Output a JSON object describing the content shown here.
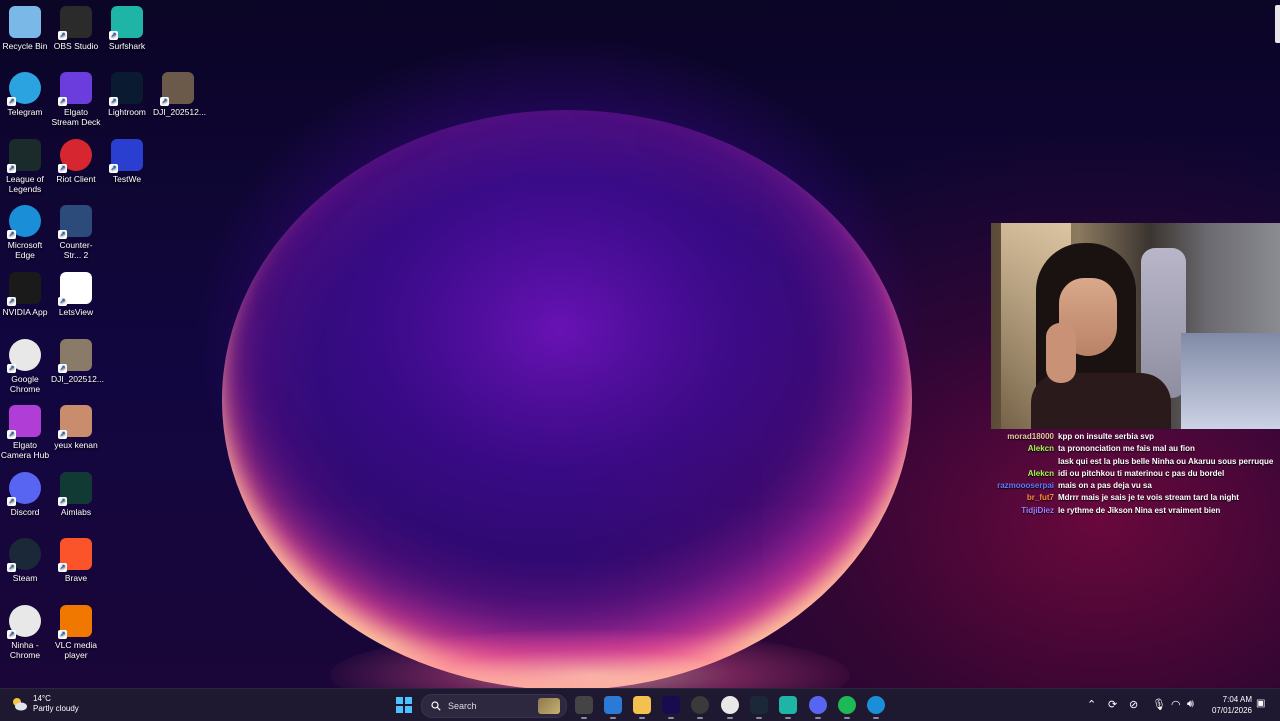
{
  "desktop": {
    "icons": [
      {
        "label": "Recycle Bin",
        "icon": "recycle-bin-icon",
        "color": "#7ab8e8"
      },
      {
        "label": "OBS Studio",
        "icon": "obs-studio-icon",
        "color": "#2b2b2b"
      },
      {
        "label": "Surfshark",
        "icon": "surfshark-icon",
        "color": "#1eb4a6"
      },
      {
        "label": "Telegram",
        "icon": "telegram-icon",
        "color": "#2aa3e0"
      },
      {
        "label": "Elgato Stream Deck",
        "icon": "stream-deck-icon",
        "color": "#6b3ddc"
      },
      {
        "label": "Lightroom",
        "icon": "lightroom-icon",
        "color": "#0a1a30"
      },
      {
        "label": "DJI_202512...",
        "icon": "video-file-icon",
        "color": "#6b5a4a"
      },
      {
        "label": "League of Legends",
        "icon": "league-of-legends-icon",
        "color": "#1b2a2a"
      },
      {
        "label": "Riot Client",
        "icon": "riot-client-icon",
        "color": "#d6262f"
      },
      {
        "label": "TestWe",
        "icon": "testwe-icon",
        "color": "#2a3fd0"
      },
      {
        "label": "Microsoft Edge",
        "icon": "edge-icon",
        "color": "#1a8fd8"
      },
      {
        "label": "Counter-Str... 2",
        "icon": "counter-strike-icon",
        "color": "#2c4a7a"
      },
      {
        "label": "NVIDIA App",
        "icon": "nvidia-icon",
        "color": "#1a1a1a"
      },
      {
        "label": "LetsView",
        "icon": "letsview-icon",
        "color": "#ffffff"
      },
      {
        "label": "Google Chrome",
        "icon": "chrome-icon",
        "color": "#e8e8e8"
      },
      {
        "label": "DJI_202512...",
        "icon": "video-file-icon",
        "color": "#8a7a68"
      },
      {
        "label": "Elgato Camera Hub",
        "icon": "camera-hub-icon",
        "color": "#b03dd6"
      },
      {
        "label": "yeux kenan",
        "icon": "image-file-icon",
        "color": "#c98c6c"
      },
      {
        "label": "Discord",
        "icon": "discord-icon",
        "color": "#5865f2"
      },
      {
        "label": "Aimlabs",
        "icon": "aimlabs-icon",
        "color": "#123a34"
      },
      {
        "label": "Steam",
        "icon": "steam-icon",
        "color": "#1b2838"
      },
      {
        "label": "Brave",
        "icon": "brave-icon",
        "color": "#fb542b"
      },
      {
        "label": "Ninha - Chrome",
        "icon": "chrome-profile-icon",
        "color": "#e8e8e8"
      },
      {
        "label": "VLC media player",
        "icon": "vlc-icon",
        "color": "#f07800"
      }
    ]
  },
  "chat": {
    "messages": [
      {
        "user": "morad18000",
        "color": "#e8c8a0",
        "text": "kpp on insulte serbia svp"
      },
      {
        "user": "Alekcn",
        "color": "#9cff4a",
        "text": "ta prononciation me fais mal au fion"
      },
      {
        "user": "",
        "color": "#ffffff",
        "text": "lask qui est la plus belle Ninha ou Akaruu sous perruque"
      },
      {
        "user": "Alekcn",
        "color": "#9cff4a",
        "text": "idi ou pitchkou ti materinou c pas du bordel"
      },
      {
        "user": "razmoooserpai",
        "color": "#5a7cff",
        "text": "mais on a pas deja vu sa"
      },
      {
        "user": "br_fut7",
        "color": "#ff8a3a",
        "text": "Mdrrr mais je sais je te vois stream tard la night"
      },
      {
        "user": "TidjiDiez",
        "color": "#9a7cff",
        "text": "le rythme de Jikson Nina est vraiment bien"
      }
    ]
  },
  "taskbar": {
    "weather": {
      "temp": "14°C",
      "condition": "Partly cloudy"
    },
    "search_placeholder": "Search",
    "apps": [
      {
        "name": "file-explorer-preview",
        "icon": "task-view-icon",
        "color": "#444"
      },
      {
        "name": "copilot",
        "icon": "m365-icon",
        "color": "#2b7bd6"
      },
      {
        "name": "file-explorer",
        "icon": "folder-icon",
        "color": "#f2c14e"
      },
      {
        "name": "premiere",
        "icon": "premiere-icon",
        "color": "#1a0a50"
      },
      {
        "name": "obs",
        "icon": "obs-icon",
        "color": "#3a3a3a"
      },
      {
        "name": "chrome",
        "icon": "chrome-icon",
        "color": "#e8e8e8"
      },
      {
        "name": "steam",
        "icon": "steam-icon",
        "color": "#1b2838"
      },
      {
        "name": "surfshark",
        "icon": "surfshark-icon",
        "color": "#1eb4a6"
      },
      {
        "name": "discord",
        "icon": "discord-icon",
        "color": "#5865f2"
      },
      {
        "name": "spotify",
        "icon": "spotify-icon",
        "color": "#1db954"
      },
      {
        "name": "edge",
        "icon": "edge-icon",
        "color": "#1a8fd8"
      }
    ],
    "clock": {
      "time": "7:04 AM",
      "date": "07/01/2026"
    }
  }
}
